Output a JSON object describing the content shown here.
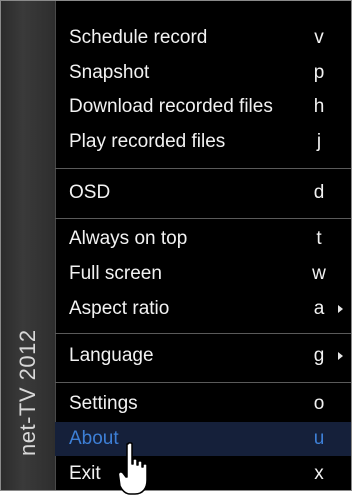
{
  "sidebar": {
    "title": "net-TV 2012"
  },
  "menu": {
    "items": [
      {
        "label": "Schedule record",
        "key": "v"
      },
      {
        "label": "Snapshot",
        "key": "p"
      },
      {
        "label": "Download recorded files",
        "key": "h"
      },
      {
        "label": "Play recorded files",
        "key": "j"
      },
      {
        "label": "OSD",
        "key": "d"
      },
      {
        "label": "Always on top",
        "key": "t"
      },
      {
        "label": "Full screen",
        "key": "w"
      },
      {
        "label": "Aspect ratio",
        "key": "a",
        "submenu": true
      },
      {
        "label": "Language",
        "key": "g",
        "submenu": true
      },
      {
        "label": "Settings",
        "key": "o"
      },
      {
        "label": "About",
        "key": "u",
        "selected": true
      },
      {
        "label": "Exit",
        "key": "x"
      }
    ]
  },
  "cursor": {
    "icon": "hand-pointer-icon"
  },
  "colors": {
    "background": "#000000",
    "text": "#f2f2f2",
    "selected_text": "#3d7fd6",
    "sidebar": "#333333"
  }
}
